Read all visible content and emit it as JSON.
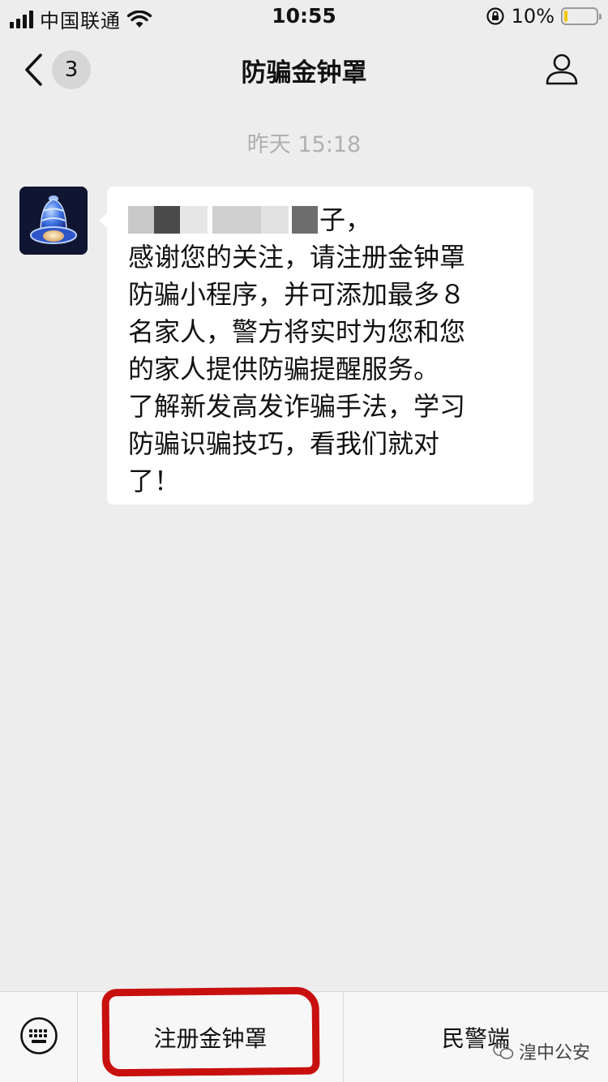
{
  "status_bar": {
    "carrier": "中国联通",
    "time": "10:55",
    "battery_percent": "10%",
    "battery_level": 0.1
  },
  "nav": {
    "unread_count": "3",
    "title": "防骗金钟罩"
  },
  "chat": {
    "timestamp": "昨天 15:18",
    "message_greeting_tail": "子，",
    "message_lines": [
      "感谢您的关注，请注册金钟罩",
      "防骗小程序，并可添加最多８",
      "名家人，警方将实时为您和您",
      "的家人提供防骗提醒服务。",
      "了解新发高发诈骗手法，学习",
      "防骗识骗技巧，看我们就对",
      "了！"
    ]
  },
  "menu": {
    "items": [
      {
        "label": "注册金钟罩"
      },
      {
        "label": "民警端"
      }
    ]
  },
  "watermark": {
    "text": "湟中公安"
  },
  "colors": {
    "background": "#ededed",
    "bubble": "#ffffff",
    "highlight_red": "#c8100f",
    "battery_yellow": "#f3c400"
  }
}
